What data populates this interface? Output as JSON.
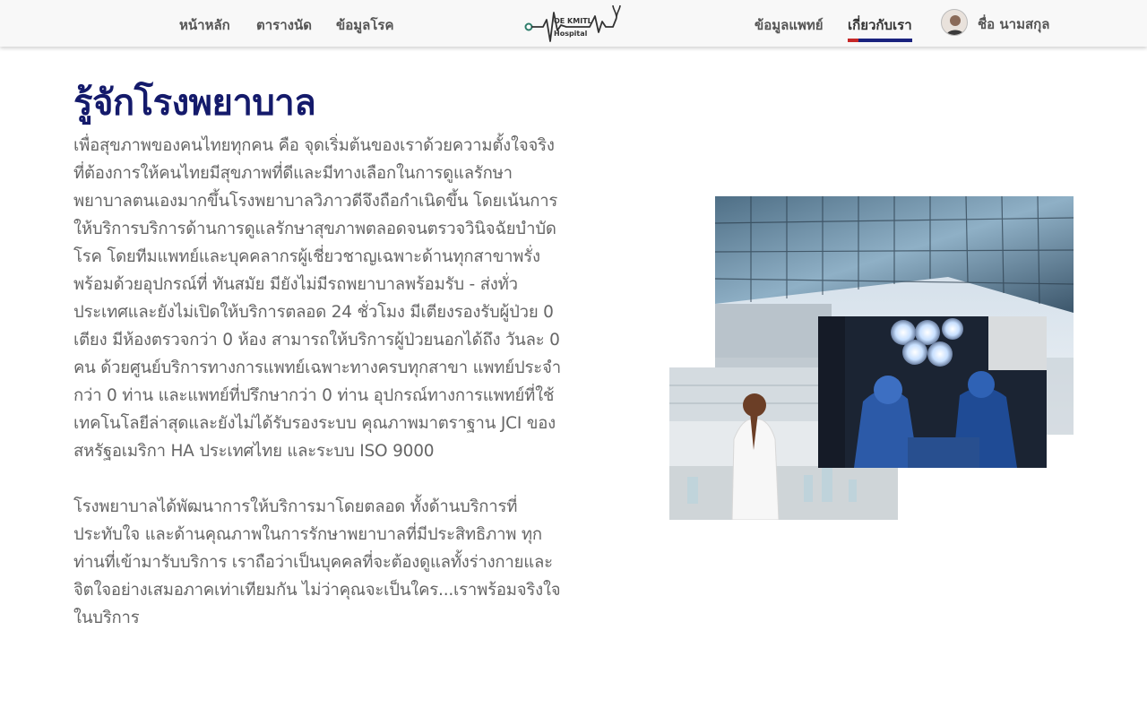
{
  "nav": {
    "home": "หน้าหลัก",
    "schedule": "ตารางนัด",
    "diseases": "ข้อมูลโรค",
    "doctors": "ข้อมูลแพทย์",
    "about": "เกี่ยวกับเรา",
    "user_name": "ชื่อ นามสกุล"
  },
  "logo": {
    "line1": "OE KMITL",
    "line2": "Hospital"
  },
  "page": {
    "title": "รู้จักโรงพยาบาล",
    "paragraph1": "เพื่อสุขภาพของคนไทยทุกคน คือ จุดเริ่มต้นของเราด้วยความตั้งใจจริงที่ต้องการให้คนไทยมีสุขภาพที่ดีและมีทางเลือกในการดูแลรักษาพยาบาลตนเองมากขึ้นโรงพยาบาลวิภาวดีจึงถือกำเนิดขึ้น  โดยเน้นการให้บริการบริการด้านการดูแลรักษาสุขภาพตลอดจนตรวจวินิจฉัยบำบัดโรค โดยทีมแพทย์และบุคคลากรผู้เชี่ยวชาญเฉพาะด้านทุกสาขาพรั่งพร้อมด้วยอุปกรณ์ที่ ทันสมัย มียังไม่มีรถพยาบาลพร้อมรับ - ส่งทั่วประเทศและยังไม่เปิดให้บริการตลอด 24 ชั่วโมง มีเตียงรองรับผู้ป่วย 0 เตียง มีห้องตรวจกว่า 0 ห้อง สามารถให้บริการผู้ป่วยนอกได้ถึง วันละ 0 คน ด้วยศูนย์บริการทางการแพทย์เฉพาะทางครบทุกสาขา แพทย์ประจำกว่า 0 ท่าน และแพทย์ที่ปรึกษากว่า 0 ท่าน อุปกรณ์ทางการแพทย์ที่ใช้เทคโนโลยีล่าสุดและยังไม่ได้รับรองระบบ คุณภาพมาตราฐาน JCI ของสหรัฐอเมริกา HA ประเทศไทย และระบบ ISO 9000",
    "paragraph2": "โรงพยาบาลได้พัฒนาการให้บริการมาโดยตลอด ทั้งด้านบริการที่ประทับใจ และด้านคุณภาพในการรักษาพยาบาลที่มีประสิทธิภาพ ทุกท่านที่เข้ามารับบริการ เราถือว่าเป็นบุคคลที่จะต้องดูแลทั้งร่างกายและจิตใจอย่างเสมอภาคเท่าเทียมกัน ไม่ว่าคุณจะเป็นใคร...เราพร้อมจริงใจในบริการ"
  },
  "colors": {
    "title": "#141a6b",
    "active_underline_blue": "#1a237e",
    "active_underline_red": "#c62828",
    "navbar_bg": "#f8f8f8"
  }
}
